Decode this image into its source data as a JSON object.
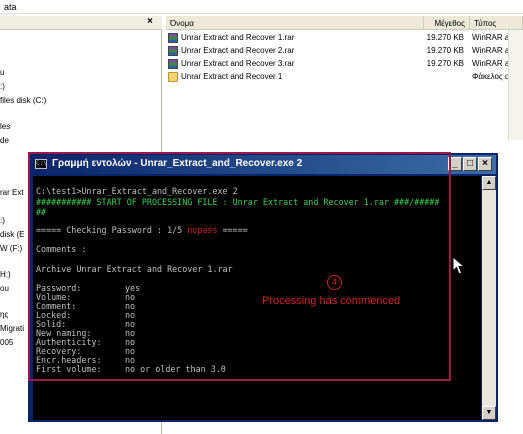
{
  "explorer": {
    "title_fragment": "ata",
    "left_pane": {
      "close_glyph": "×",
      "items": [
        "u",
        ":)",
        "files disk (C:)",
        "les",
        "de",
        "rar Ext",
        ":)",
        "disk (E",
        "W (F:)",
        "H:)",
        "ou",
        "ης",
        "Migrati",
        "005"
      ]
    },
    "columns": {
      "name": "Όνομα",
      "size": "Μέγεθος",
      "type": "Τύπος"
    },
    "files": [
      {
        "icon": "rar-archive-icon",
        "name": "Unrar Extract and Recover 1.rar",
        "size": "19.270 KB",
        "type": "WinRAR ar"
      },
      {
        "icon": "rar-archive-icon",
        "name": "Unrar Extract and Recover 2.rar",
        "size": "19.270 KB",
        "type": "WinRAR ar"
      },
      {
        "icon": "rar-archive-icon",
        "name": "Unrar Extract and Recover 3.rar",
        "size": "19.270 KB",
        "type": "WinRAR ar"
      },
      {
        "icon": "folder-icon",
        "name": "Unrar Extract and Recover 1",
        "size": "",
        "type": "Φάκελος α"
      }
    ]
  },
  "console": {
    "title": "Γραμμή εντολών - Unrar_Extract_and_Recover.exe 2",
    "icon_label": "C:\\",
    "buttons": {
      "minimize": "_",
      "maximize": "□",
      "close": "×"
    },
    "lines": {
      "cmd": "C:\\test1>Unrar_Extract_and_Recover.exe 2",
      "start_a": "########### START OF PROCESSING FILE : Unrar Extract and Recover 1.rar ###/#####",
      "start_b": "##",
      "check_prefix": "===== Checking Password : 1/5 ",
      "check_nopass": "nopass",
      "check_suffix": " =====",
      "comments": "Comments :",
      "archive": "Archive Unrar Extract and Recover 1.rar"
    },
    "properties": [
      {
        "label": "Password:",
        "value": "yes"
      },
      {
        "label": "Volume:",
        "value": "no"
      },
      {
        "label": "Comment:",
        "value": "no"
      },
      {
        "label": "Locked:",
        "value": "no"
      },
      {
        "label": "Solid:",
        "value": "no"
      },
      {
        "label": "New naming:",
        "value": "no"
      },
      {
        "label": "Authenticity:",
        "value": "no"
      },
      {
        "label": "Recovery:",
        "value": "no"
      },
      {
        "label": "Encr.headers:",
        "value": "no"
      },
      {
        "label": "First volume:",
        "value": "no or older than 3.0"
      }
    ]
  },
  "annotation": {
    "step_number": "4",
    "text": "Processing has commenced"
  },
  "colors": {
    "console_green": "#39d353",
    "annotation_red": "#d22424",
    "annotation_frame": "#a01849",
    "title_bar": "#0a246a"
  }
}
